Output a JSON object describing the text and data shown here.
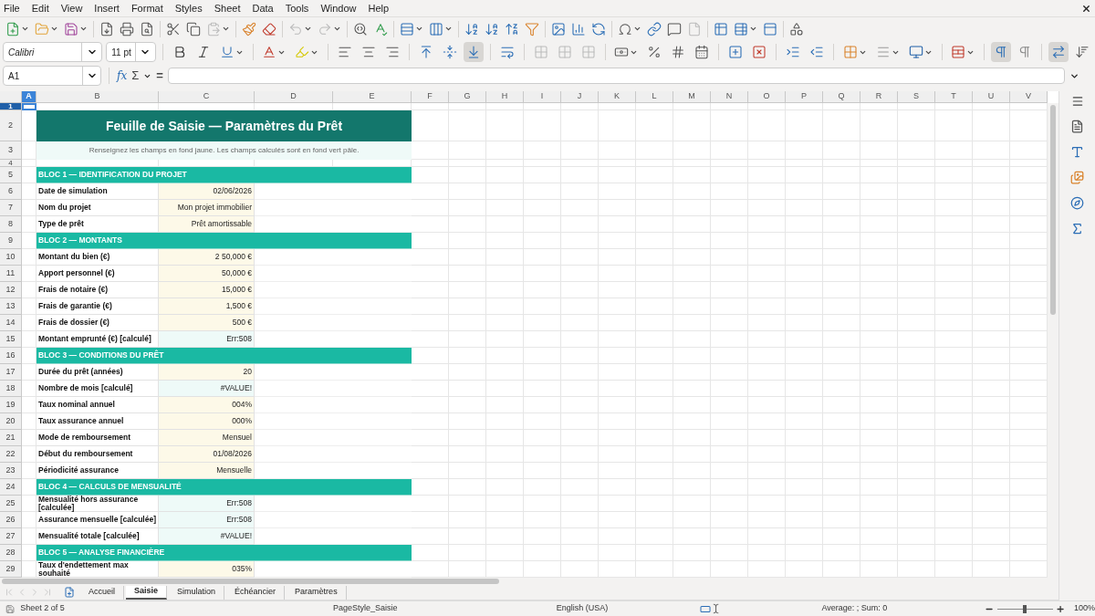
{
  "menu": [
    "File",
    "Edit",
    "View",
    "Insert",
    "Format",
    "Styles",
    "Sheet",
    "Data",
    "Tools",
    "Window",
    "Help"
  ],
  "formatting": {
    "font": "Calibri",
    "size": "11 pt"
  },
  "formula_bar": {
    "cell": "A1",
    "wizard": "fx",
    "sum": "Σ",
    "equals": "="
  },
  "columns": [
    {
      "label": "A",
      "selected": true
    },
    {
      "label": "B",
      "selected": false
    },
    {
      "label": "C",
      "selected": false
    },
    {
      "label": "D",
      "selected": false
    },
    {
      "label": "E",
      "selected": false
    },
    {
      "label": "F",
      "selected": false
    },
    {
      "label": "G",
      "selected": false
    },
    {
      "label": "H",
      "selected": false
    },
    {
      "label": "I",
      "selected": false
    },
    {
      "label": "J",
      "selected": false
    },
    {
      "label": "K",
      "selected": false
    },
    {
      "label": "L",
      "selected": false
    },
    {
      "label": "M",
      "selected": false
    },
    {
      "label": "N",
      "selected": false
    },
    {
      "label": "O",
      "selected": false
    },
    {
      "label": "P",
      "selected": false
    },
    {
      "label": "Q",
      "selected": false
    },
    {
      "label": "R",
      "selected": false
    },
    {
      "label": "S",
      "selected": false
    },
    {
      "label": "T",
      "selected": false
    },
    {
      "label": "U",
      "selected": false
    },
    {
      "label": "V",
      "selected": false
    }
  ],
  "rows": [
    {
      "number": "1",
      "selected": true,
      "kind": "spacer"
    },
    {
      "number": "2",
      "selected": false,
      "kind": "title",
      "text": "Feuille de Saisie — Paramètres du Prêt"
    },
    {
      "number": "3",
      "selected": false,
      "kind": "subtitle",
      "text": "Renseignez les champs en fond jaune. Les champs calculés sont en fond vert pâle."
    },
    {
      "number": "4",
      "selected": false,
      "kind": "spacer"
    },
    {
      "number": "5",
      "selected": false,
      "kind": "section",
      "text": "BLOC 1 — IDENTIFICATION DU PROJET"
    },
    {
      "number": "6",
      "selected": false,
      "kind": "field",
      "label": "Date de simulation",
      "value": "02/06/2026",
      "calculated": false
    },
    {
      "number": "7",
      "selected": false,
      "kind": "field",
      "label": "Nom du projet",
      "value": "Mon projet immobilier",
      "calculated": false
    },
    {
      "number": "8",
      "selected": false,
      "kind": "field",
      "label": "Type de prêt",
      "value": "Prêt amortissable",
      "calculated": false
    },
    {
      "number": "9",
      "selected": false,
      "kind": "section",
      "text": "BLOC 2 — MONTANTS"
    },
    {
      "number": "10",
      "selected": false,
      "kind": "field",
      "label": "Montant du bien (€)",
      "value": "2 50,000 €",
      "calculated": false
    },
    {
      "number": "11",
      "selected": false,
      "kind": "field",
      "label": "Apport personnel (€)",
      "value": "50,000 €",
      "calculated": false
    },
    {
      "number": "12",
      "selected": false,
      "kind": "field",
      "label": "Frais de notaire (€)",
      "value": "15,000 €",
      "calculated": false
    },
    {
      "number": "13",
      "selected": false,
      "kind": "field",
      "label": "Frais de garantie (€)",
      "value": "1,500 €",
      "calculated": false
    },
    {
      "number": "14",
      "selected": false,
      "kind": "field",
      "label": "Frais de dossier (€)",
      "value": "500 €",
      "calculated": false
    },
    {
      "number": "15",
      "selected": false,
      "kind": "field",
      "label": "Montant emprunté (€) [calculé]",
      "value": "Err:508",
      "calculated": true
    },
    {
      "number": "16",
      "selected": false,
      "kind": "section",
      "text": "BLOC 3 — CONDITIONS DU PRÊT"
    },
    {
      "number": "17",
      "selected": false,
      "kind": "field",
      "label": "Durée du prêt (années)",
      "value": "20",
      "calculated": false
    },
    {
      "number": "18",
      "selected": false,
      "kind": "field",
      "label": "Nombre de mois [calculé]",
      "value": "#VALUE!",
      "calculated": true
    },
    {
      "number": "19",
      "selected": false,
      "kind": "field",
      "label": "Taux nominal annuel",
      "value": "004%",
      "calculated": false
    },
    {
      "number": "20",
      "selected": false,
      "kind": "field",
      "label": "Taux assurance annuel",
      "value": "000%",
      "calculated": false
    },
    {
      "number": "21",
      "selected": false,
      "kind": "field",
      "label": "Mode de remboursement",
      "value": "Mensuel",
      "calculated": false
    },
    {
      "number": "22",
      "selected": false,
      "kind": "field",
      "label": "Début du remboursement",
      "value": "01/08/2026",
      "calculated": false
    },
    {
      "number": "23",
      "selected": false,
      "kind": "field",
      "label": "Périodicité assurance",
      "value": "Mensuelle",
      "calculated": false
    },
    {
      "number": "24",
      "selected": false,
      "kind": "section",
      "text": "BLOC 4 — CALCULS DE MENSUALITÉ"
    },
    {
      "number": "25",
      "selected": false,
      "kind": "field",
      "label": "Mensualité hors assurance [calculée]",
      "value": "Err:508",
      "calculated": true
    },
    {
      "number": "26",
      "selected": false,
      "kind": "field",
      "label": "Assurance mensuelle [calculée]",
      "value": "Err:508",
      "calculated": true
    },
    {
      "number": "27",
      "selected": false,
      "kind": "field",
      "label": "Mensualité totale [calculée]",
      "value": "#VALUE!",
      "calculated": true
    },
    {
      "number": "28",
      "selected": false,
      "kind": "section",
      "text": "BLOC 5 — ANALYSE FINANCIÈRE"
    },
    {
      "number": "29",
      "selected": false,
      "kind": "field",
      "label": "Taux d'endettement max souhaité",
      "value": "035%",
      "calculated": false
    }
  ],
  "sheet_tabs": [
    {
      "label": "Accueil",
      "selected": false
    },
    {
      "label": "Saisie",
      "selected": true
    },
    {
      "label": "Simulation",
      "selected": false
    },
    {
      "label": "Échéancier",
      "selected": false
    },
    {
      "label": "Paramètres",
      "selected": false
    }
  ],
  "status_bar": {
    "sheet": "Sheet 2 of 5",
    "page_style": "PageStyle_Saisie",
    "language": "English (USA)",
    "summary": "Average: ; Sum: 0",
    "zoom": {
      "level": 0.5
    },
    "zoom_label": "100%"
  }
}
